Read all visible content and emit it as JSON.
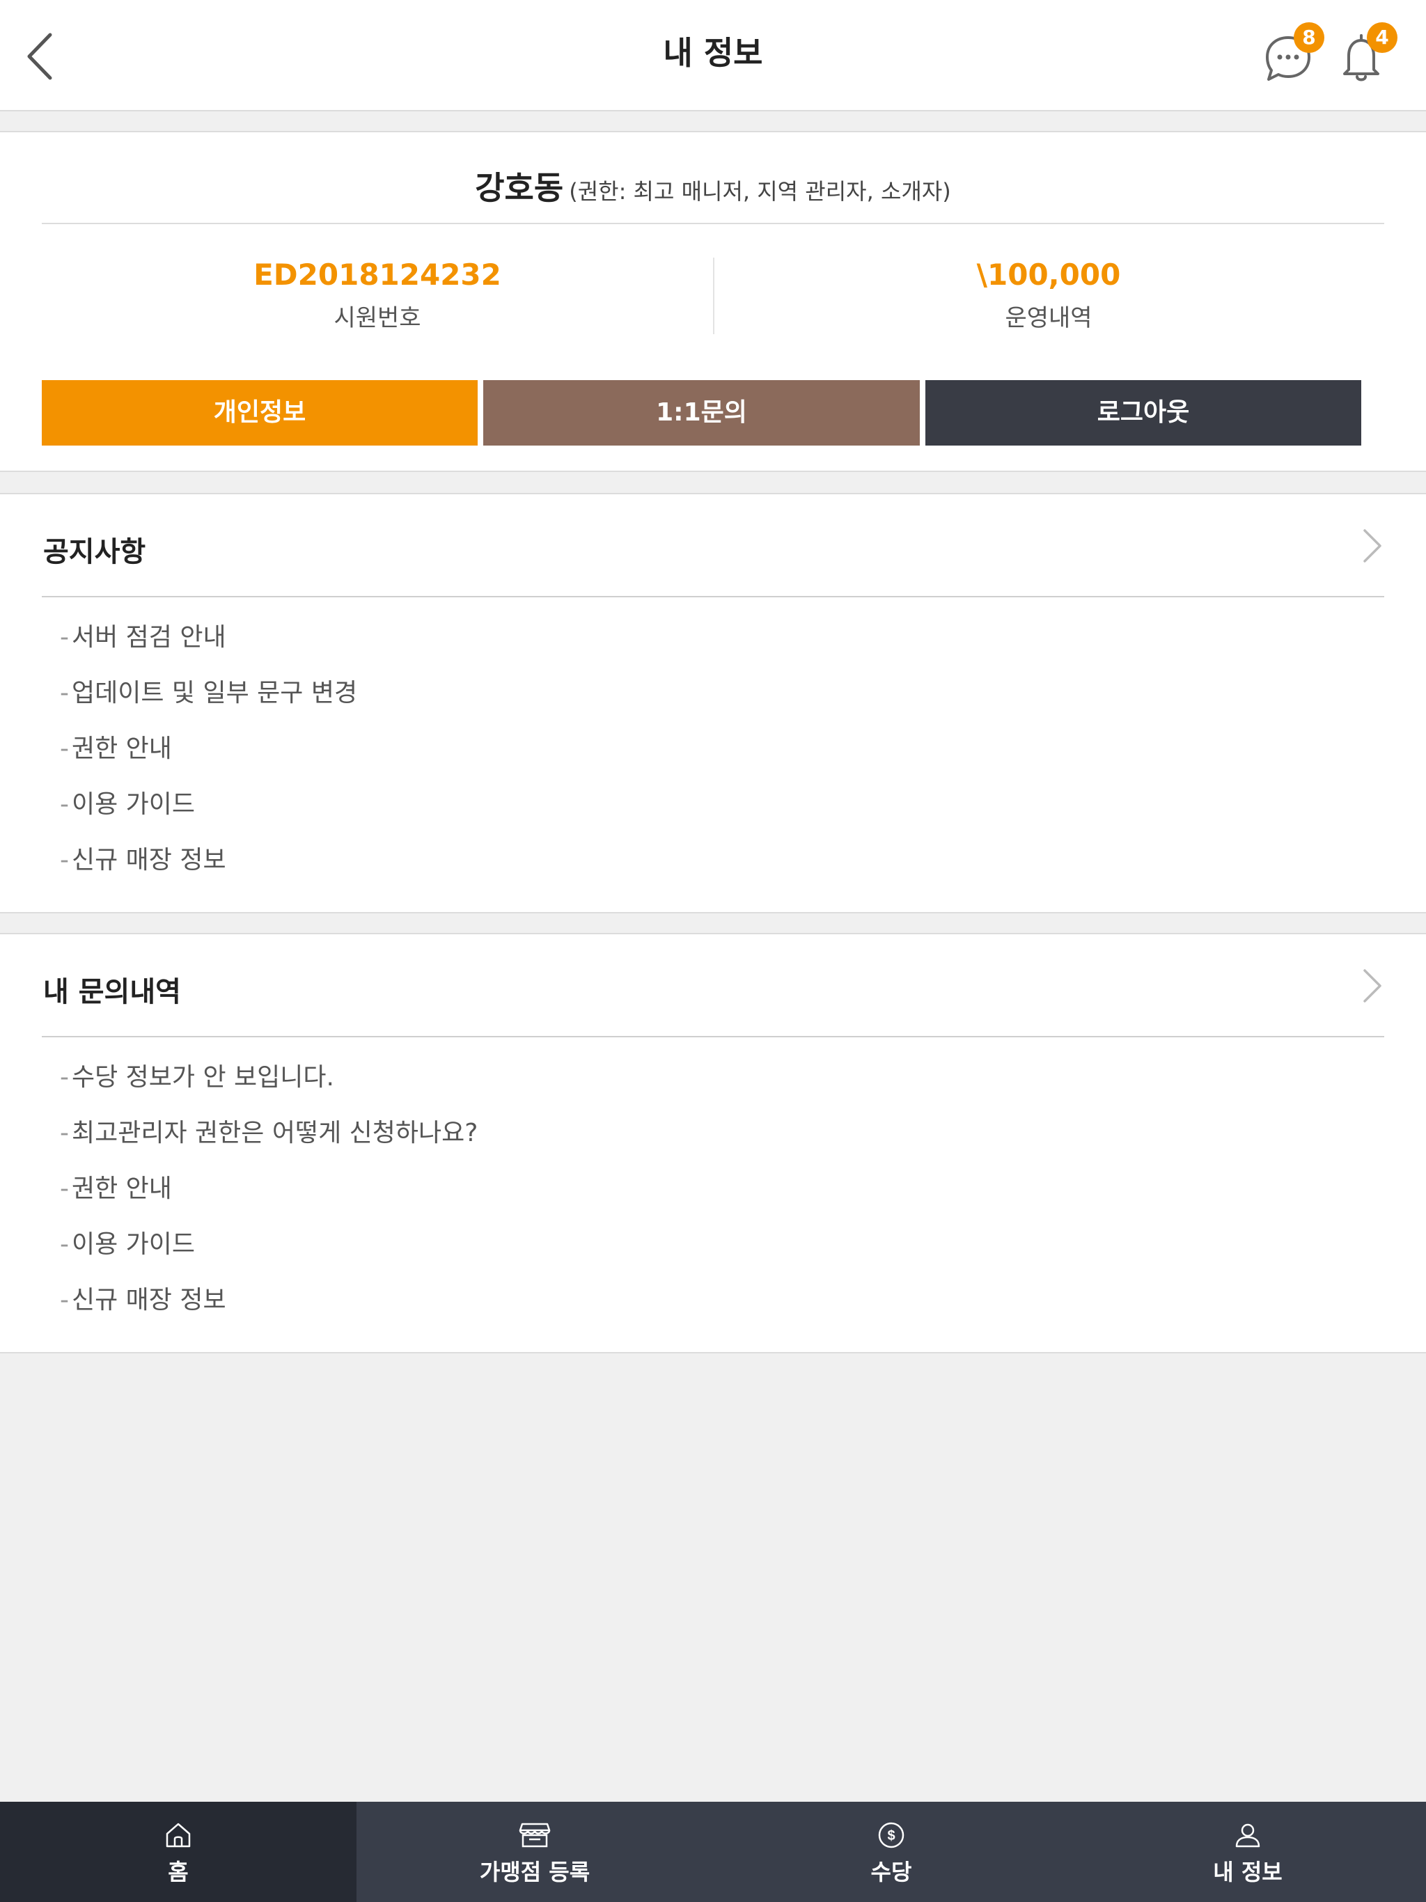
{
  "header": {
    "title": "내 정보",
    "chat_badge": "8",
    "bell_badge": "4"
  },
  "profile": {
    "name": "강호동",
    "role": "(권한: 최고 매니저, 지역 관리자, 소개자)",
    "member_id": "ED2018124232",
    "member_id_label": "시원번호",
    "amount": "\\100,000",
    "amount_label": "운영내역",
    "buttons": [
      "개인정보",
      "1:1문의",
      "로그아웃"
    ]
  },
  "notices": {
    "title": "공지사항",
    "items": [
      "서버 점검 안내",
      "업데이트 및 일부 문구 변경",
      "권한 안내",
      "이용 가이드",
      "신규 매장 정보"
    ]
  },
  "inquiries": {
    "title": "내 문의내역",
    "items": [
      "수당 정보가 안 보입니다.",
      "최고관리자 권한은 어떻게 신청하나요?",
      "권한 안내",
      "이용 가이드",
      "신규 매장 정보"
    ]
  },
  "list_dash": "-",
  "nav": {
    "items": [
      {
        "label": "홈",
        "icon": "home-icon"
      },
      {
        "label": "가맹점 등록",
        "icon": "store-icon"
      },
      {
        "label": "수당",
        "icon": "dollar-icon"
      },
      {
        "label": "내 정보",
        "icon": "user-icon"
      }
    ]
  },
  "colors": {
    "accent": "#f39200",
    "inquiry_button": "#8b6a5b",
    "logout_button": "#393c45",
    "nav_bg": "#393e4a",
    "nav_active": "#262a33"
  }
}
